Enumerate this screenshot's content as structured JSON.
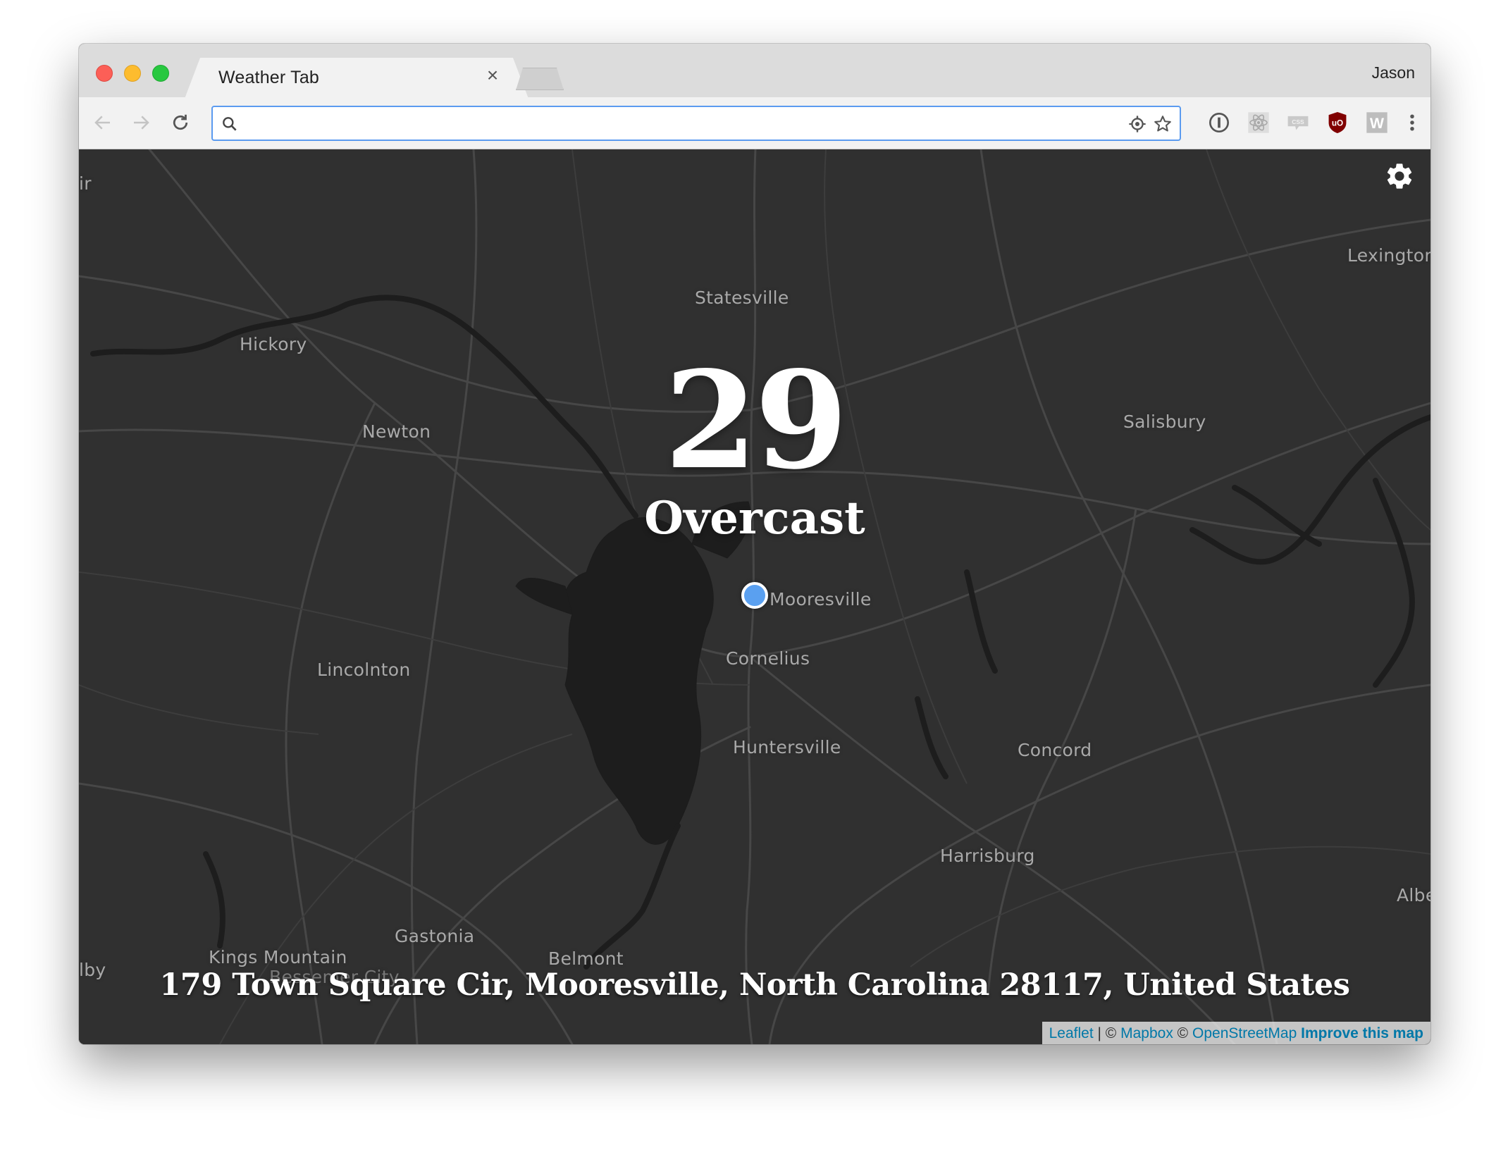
{
  "browser": {
    "tab_title": "Weather Tab",
    "tab_close": "×",
    "profile_name": "Jason",
    "omnibox_value": "",
    "extensions": [
      "1password-icon",
      "react-devtools-icon",
      "css-viewer-icon",
      "ublock-origin-icon",
      "w-extension-icon"
    ]
  },
  "weather": {
    "temperature": "29",
    "condition": "Overcast",
    "address": "179 Town Square Cir, Mooresville, North Carolina 28117, United States"
  },
  "map": {
    "places": {
      "statesville": "Statesville",
      "hickory": "Hickory",
      "newton": "Newton",
      "lexington": "Lexington",
      "salisbury": "Salisbury",
      "mooresville": "Mooresville",
      "lincolnton": "Lincolnton",
      "cornelius": "Cornelius",
      "huntersville": "Huntersville",
      "concord": "Concord",
      "harrisburg": "Harrisburg",
      "gastonia": "Gastonia",
      "kings_mountain": "Kings Mountain",
      "belmont": "Belmont",
      "bessemer_city": "Bessemer City",
      "edge_left_top": "ir",
      "edge_left_bottom": "lby",
      "edge_right": "Albe"
    },
    "colors": {
      "background": "#303030",
      "roads": "#454545",
      "water": "#1c1c1c",
      "marker": "#5aa0f0"
    }
  },
  "attribution": {
    "leaflet": "Leaflet",
    "sep1": " | © ",
    "mapbox": "Mapbox",
    "sep2": " © ",
    "osm": "OpenStreetMap",
    "improve": "Improve this map"
  }
}
